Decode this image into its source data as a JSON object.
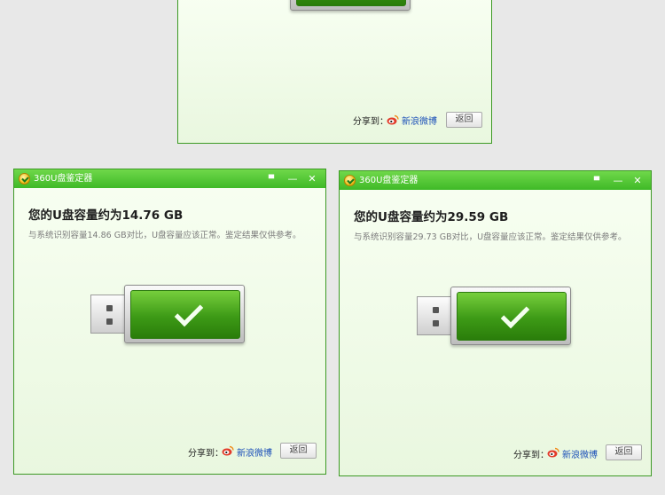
{
  "top_window": {
    "share_label": "分享到：",
    "weibo_label": "新浪微博",
    "back_label": "返回"
  },
  "left_window": {
    "title": "360U盘鉴定器",
    "feedback_glyph": "▀",
    "minimize_glyph": "—",
    "close_glyph": "✕",
    "heading": "您的U盘容量约为14.76 GB",
    "subtext": "与系统识别容量14.86 GB对比，U盘容量应该正常。鉴定结果仅供参考。",
    "share_label": "分享到：",
    "weibo_label": "新浪微博",
    "back_label": "返回"
  },
  "right_window": {
    "title": "360U盘鉴定器",
    "feedback_glyph": "▀",
    "minimize_glyph": "—",
    "close_glyph": "✕",
    "heading": "您的U盘容量约为29.59 GB",
    "subtext": "与系统识别容量29.73 GB对比，U盘容量应该正常。鉴定结果仅供参考。",
    "share_label": "分享到：",
    "weibo_label": "新浪微博",
    "back_label": "返回"
  },
  "icons": {
    "app_logo": "360-logo-icon",
    "usb": "usb-drive-icon",
    "check": "checkmark-icon",
    "weibo": "sina-weibo-icon"
  },
  "colors": {
    "titlebar": "#4cc22f",
    "window_bg": "#eef9e6",
    "usb_green": "#4aa81c",
    "link": "#1a4fb8"
  }
}
